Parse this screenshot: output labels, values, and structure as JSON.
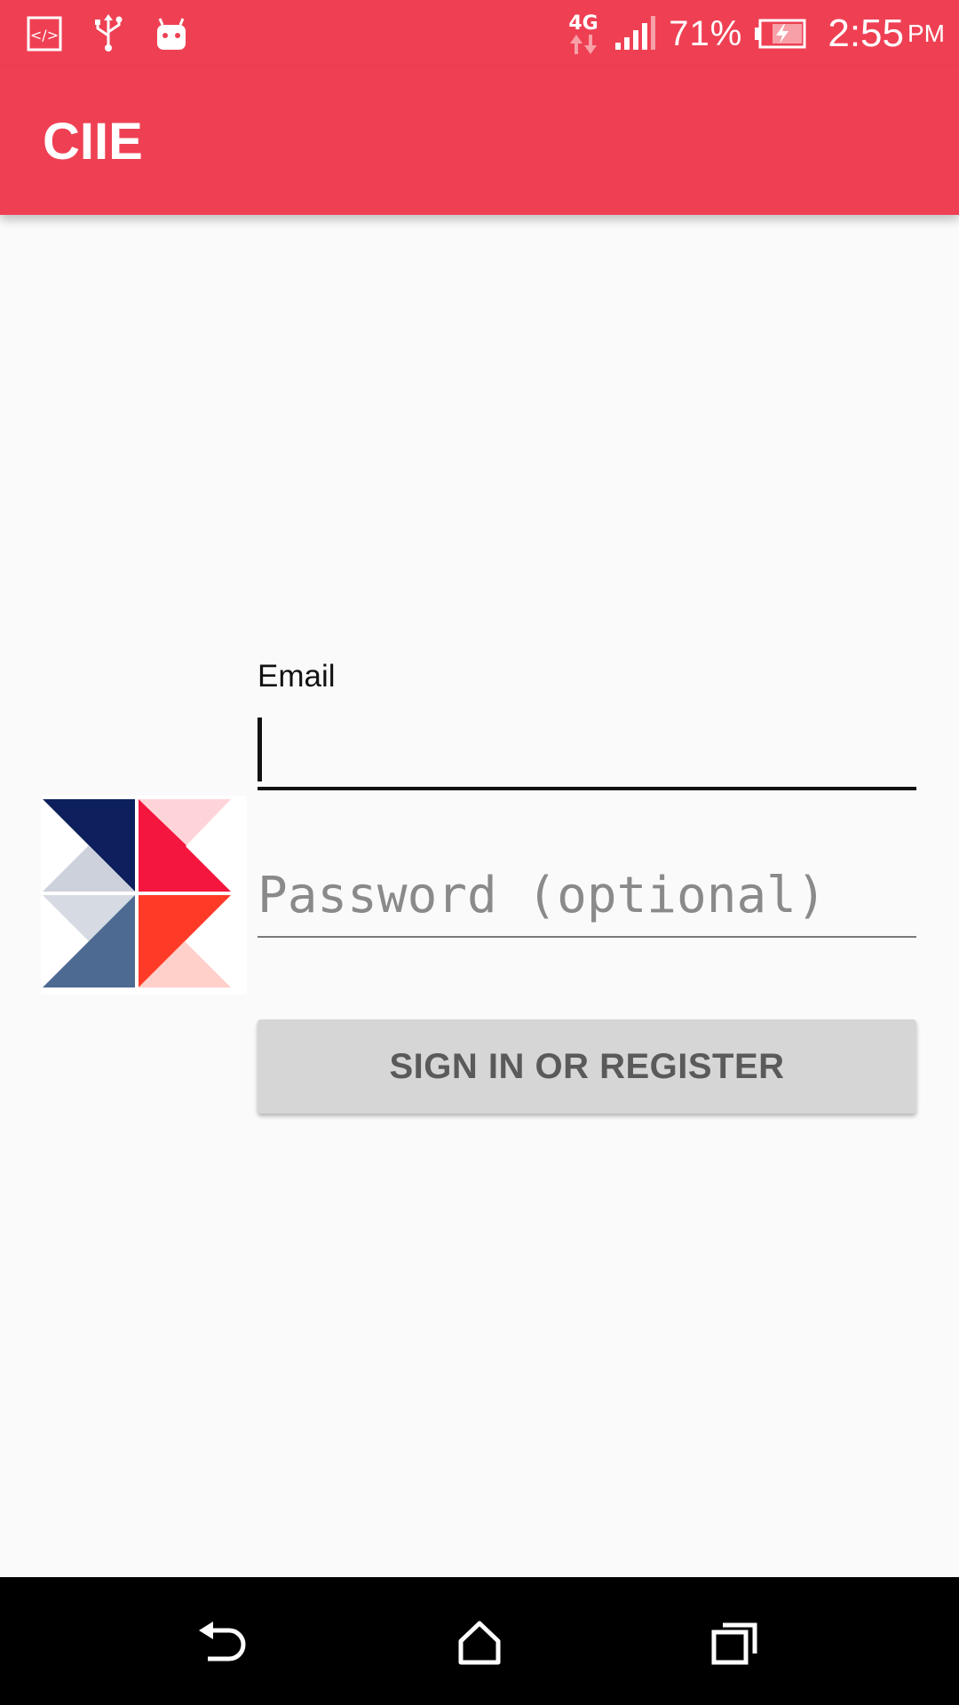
{
  "status_bar": {
    "icons_left": [
      "code-icon",
      "usb-icon",
      "android-icon"
    ],
    "network": "4G",
    "battery_percent": "71%",
    "time": "2:55",
    "ampm": "PM",
    "color": "#ef4053"
  },
  "app_bar": {
    "title": "CIIE",
    "color": "#ef4053"
  },
  "form": {
    "email_label": "Email",
    "email_value": "",
    "password_placeholder": "Password (optional)",
    "password_value": "",
    "submit_label": "SIGN IN OR REGISTER"
  },
  "nav_bar": {
    "icons": [
      "back-icon",
      "home-icon",
      "recents-icon"
    ]
  }
}
